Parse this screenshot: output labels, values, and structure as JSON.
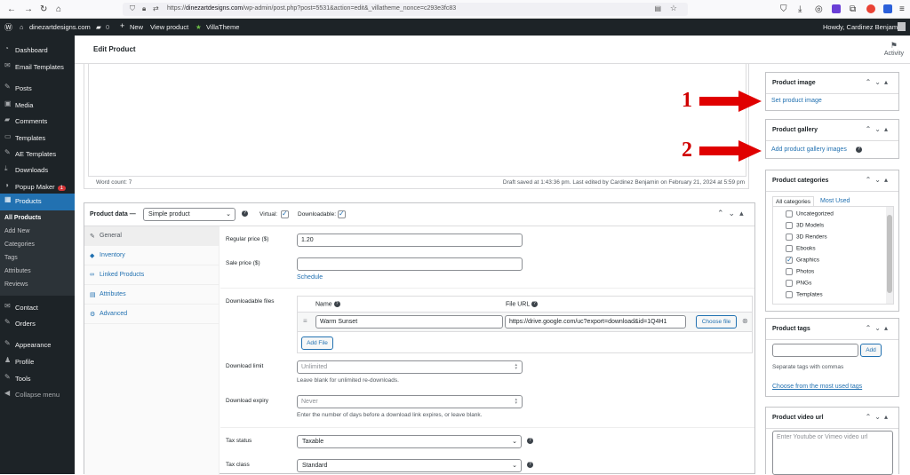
{
  "browser": {
    "url_prefix": "https://",
    "url_domain": "dinezartdesigns.com",
    "url_rest": "/wp-admin/post.php?post=5531&action=edit&_villatheme_nonce=c293e3fc83"
  },
  "adminbar": {
    "site": "dinezartdesigns.com",
    "comments": "0",
    "new": "New",
    "view": "View product",
    "villatheme": "VillaTheme",
    "howdy": "Howdy, Cardinez Benjamin"
  },
  "sidebar": {
    "items": [
      {
        "label": "Dashboard",
        "icon": "dashboard-icon"
      },
      {
        "label": "Email Templates",
        "icon": "email-icon"
      },
      {
        "label": "Posts",
        "icon": "pin-icon"
      },
      {
        "label": "Media",
        "icon": "media-icon"
      },
      {
        "label": "Comments",
        "icon": "comment-icon"
      },
      {
        "label": "Templates",
        "icon": "folder-icon"
      },
      {
        "label": "AE Templates",
        "icon": "pin-icon"
      },
      {
        "label": "Downloads",
        "icon": "download-icon"
      },
      {
        "label": "Popup Maker",
        "icon": "popup-icon",
        "badge": "1"
      },
      {
        "label": "Products",
        "icon": "products-icon"
      }
    ],
    "submenu": [
      "All Products",
      "Add New",
      "Categories",
      "Tags",
      "Attributes",
      "Reviews"
    ],
    "items2": [
      {
        "label": "Contact",
        "icon": "email-icon"
      },
      {
        "label": "Orders",
        "icon": "pin-icon"
      },
      {
        "label": "Appearance",
        "icon": "brush-icon"
      },
      {
        "label": "Profile",
        "icon": "user-icon"
      },
      {
        "label": "Tools",
        "icon": "wrench-icon"
      },
      {
        "label": "Collapse menu",
        "icon": "collapse-icon"
      }
    ]
  },
  "header": {
    "title": "Edit Product",
    "activity": "Activity"
  },
  "editor": {
    "word_count": "Word count: 7",
    "draft_saved": "Draft saved at 1:43:36 pm. Last edited by Cardinez Benjamin on February 21, 2024 at 5:59 pm"
  },
  "product_data": {
    "title": "Product data —",
    "type_selected": "Simple product",
    "virtual_label": "Virtual:",
    "downloadable_label": "Downloadable:",
    "tabs": [
      "General",
      "Inventory",
      "Linked Products",
      "Attributes",
      "Advanced"
    ],
    "regular_price_label": "Regular price ($)",
    "regular_price": "1.20",
    "sale_price_label": "Sale price ($)",
    "schedule": "Schedule",
    "downloadable_files_label": "Downloadable files",
    "col_name": "Name",
    "col_url": "File URL",
    "file_name": "Warm Sunset",
    "file_url": "https://drive.google.com/uc?export=download&id=1Q4H1",
    "choose_file": "Choose file",
    "add_file": "Add File",
    "download_limit_label": "Download limit",
    "download_limit_ph": "Unlimited",
    "download_limit_hint": "Leave blank for unlimited re-downloads.",
    "download_expiry_label": "Download expiry",
    "download_expiry_ph": "Never",
    "download_expiry_hint": "Enter the number of days before a download link expires, or leave blank.",
    "tax_status_label": "Tax status",
    "tax_status": "Taxable",
    "tax_class_label": "Tax class",
    "tax_class": "Standard"
  },
  "right": {
    "product_image": {
      "title": "Product image",
      "link": "Set product image"
    },
    "product_gallery": {
      "title": "Product gallery",
      "link": "Add product gallery images"
    },
    "categories": {
      "title": "Product categories",
      "tab_all": "All categories",
      "tab_used": "Most Used",
      "items": [
        {
          "label": "Uncategorized",
          "checked": false
        },
        {
          "label": "3D Models",
          "checked": false
        },
        {
          "label": "3D Renders",
          "checked": false
        },
        {
          "label": "Ebooks",
          "checked": false
        },
        {
          "label": "Graphics",
          "checked": true
        },
        {
          "label": "Photos",
          "checked": false
        },
        {
          "label": "PNGs",
          "checked": false
        },
        {
          "label": "Templates",
          "checked": false
        }
      ]
    },
    "tags": {
      "title": "Product tags",
      "add": "Add",
      "hint": "Separate tags with commas",
      "choose": "Choose from the most used tags"
    },
    "video": {
      "title": "Product video url",
      "placeholder": "Enter Youtube or Vimeo video url"
    }
  },
  "annotations": {
    "one": "1",
    "two": "2"
  },
  "colors": {
    "accent": "#2271b1",
    "admin_dark": "#1d2327",
    "arrow": "#e00000"
  }
}
